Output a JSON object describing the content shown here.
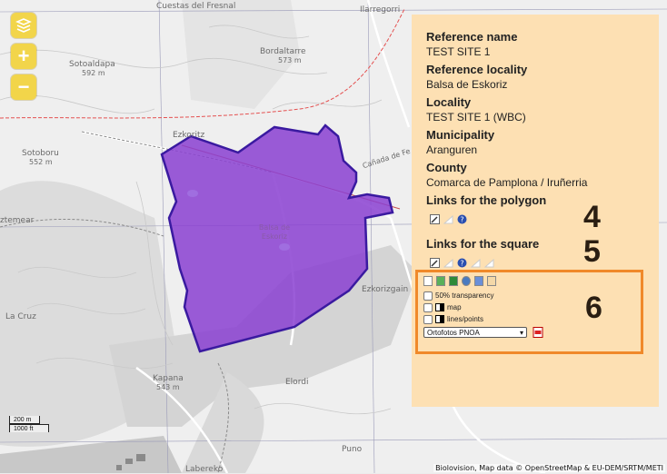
{
  "map": {
    "labels": [
      "Cuestas del Fresnal",
      "Ilarregorri",
      "Sotoaldapa",
      "592 m",
      "Bordaltarre",
      "573 m",
      "Sotoboru",
      "552 m",
      "Ezkoritz",
      "Ezkorizgain",
      "La Cruz",
      "Kapana",
      "543 m",
      "Elordi",
      "Puno",
      "Labereko",
      "Cañada de Fe",
      "Balsa de Eskoriz",
      "ztemear"
    ],
    "polygon_color": "#8a3fd1"
  },
  "controls": {
    "layers_icon": "layers-icon",
    "zoom_in": "+",
    "zoom_out": "−"
  },
  "scale": {
    "metric": "200 m",
    "imperial": "1000 ft"
  },
  "attribution": "Biolovision, Map data © OpenStreetMap & EU-DEM/SRTM/METI",
  "panel": {
    "reference_name_label": "Reference name",
    "reference_name": "TEST SITE 1",
    "reference_locality_label": "Reference locality",
    "reference_locality": "Balsa de Eskoriz",
    "locality_label": "Locality",
    "locality": "TEST SITE 1 (WBC)",
    "municipality_label": "Municipality",
    "municipality": "Aranguren",
    "county_label": "County",
    "county": "Comarca de Pamplona / Iruñerria",
    "links_polygon_label": "Links for the polygon",
    "links_square_label": "Links for the square"
  },
  "annotations": {
    "n4": "4",
    "n5": "5",
    "n6": "6"
  },
  "tools": {
    "transparency_label": "50% transparency",
    "map_label": "map",
    "lines_label": "lines/points",
    "layer_select_value": "Ortofotos PNOA"
  },
  "colors": {
    "panel_bg": "#fde0b3",
    "highlight_border": "#f0892a",
    "controls": "#f2d54a",
    "polygon": "#8a3fd1"
  }
}
